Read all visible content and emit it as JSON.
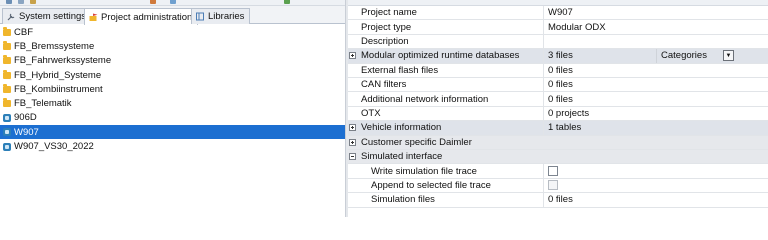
{
  "toolbar": {
    "icons": [
      "toolbar-icon-1",
      "toolbar-icon-2",
      "toolbar-icon-3",
      "toolbar-icon-4",
      "toolbar-icon-5",
      "toolbar-icon-6"
    ]
  },
  "tabs": [
    {
      "label": "System settings",
      "icon": "wrench-icon",
      "active": false
    },
    {
      "label": "Project administration",
      "icon": "folder-flag-icon",
      "active": true
    },
    {
      "label": "Libraries",
      "icon": "library-icon",
      "active": false
    }
  ],
  "tree": [
    {
      "label": "CBF",
      "kind": "folder"
    },
    {
      "label": "FB_Bremssysteme",
      "kind": "folder"
    },
    {
      "label": "FB_Fahrwerkssysteme",
      "kind": "folder"
    },
    {
      "label": "FB_Hybrid_Systeme",
      "kind": "folder"
    },
    {
      "label": "FB_Kombiinstrument",
      "kind": "folder"
    },
    {
      "label": "FB_Telematik",
      "kind": "folder"
    },
    {
      "label": "906D",
      "kind": "project"
    },
    {
      "label": "W907",
      "kind": "project",
      "selected": true
    },
    {
      "label": "W907_VS30_2022",
      "kind": "project"
    }
  ],
  "properties": {
    "project_name": {
      "label": "Project name",
      "value": "W907"
    },
    "project_type": {
      "label": "Project type",
      "value": "Modular ODX"
    },
    "description": {
      "label": "Description",
      "value": ""
    },
    "modular_db": {
      "label": "Modular optimized runtime databases",
      "value": "3 files",
      "category_label": "Categories"
    },
    "external_flash": {
      "label": "External flash files",
      "value": "0 files"
    },
    "can_filters": {
      "label": "CAN filters",
      "value": "0 files"
    },
    "additional_network": {
      "label": "Additional network information",
      "value": "0 files"
    },
    "otx": {
      "label": "OTX",
      "value": "0 projects"
    },
    "vehicle_info": {
      "label": "Vehicle information",
      "value": "1 tables"
    },
    "customer_specific": {
      "label": "Customer specific Daimler"
    },
    "simulated_interface": {
      "label": "Simulated interface"
    },
    "write_sim_trace": {
      "label": "Write simulation file trace",
      "checked": false
    },
    "append_trace": {
      "label": "Append to selected file trace",
      "checked": false
    },
    "simulation_files": {
      "label": "Simulation files",
      "value": "0 files"
    }
  },
  "colors": {
    "selection": "#1c6fd1",
    "folder": "#f0b62c",
    "project_icon": "#2c7fb8",
    "category_bg": "#e6e8ec"
  }
}
